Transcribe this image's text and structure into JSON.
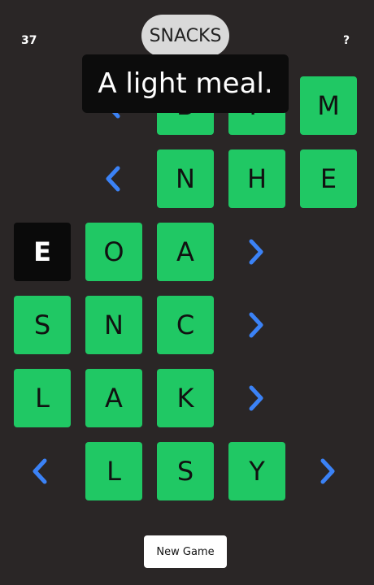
{
  "header": {
    "counter": "37",
    "title": "SNACKS",
    "help": "?"
  },
  "tooltip": "A light meal.",
  "icons": {
    "left": "chevron-left-icon",
    "right": "chevron-right-icon"
  },
  "colors": {
    "background": "#2a2626",
    "tile": "#20c864",
    "selected_tile": "#0a0a0a",
    "arrow": "#3b82f6",
    "pill": "#d9d9d9"
  },
  "grid": {
    "rows": [
      {
        "tiles": [
          "B",
          "P",
          "M"
        ],
        "arrow": "left"
      },
      {
        "tiles": [
          "N",
          "H",
          "E"
        ],
        "arrow": "left"
      },
      {
        "tiles": [
          "E",
          "O",
          "A"
        ],
        "arrow": "right",
        "selected_index": 0
      },
      {
        "tiles": [
          "S",
          "N",
          "C"
        ],
        "arrow": "right"
      },
      {
        "tiles": [
          "L",
          "A",
          "K"
        ],
        "arrow": "right"
      },
      {
        "tiles": [
          "L",
          "S",
          "Y"
        ],
        "arrow": "both"
      }
    ]
  },
  "footer": {
    "new_game_label": "New Game"
  }
}
